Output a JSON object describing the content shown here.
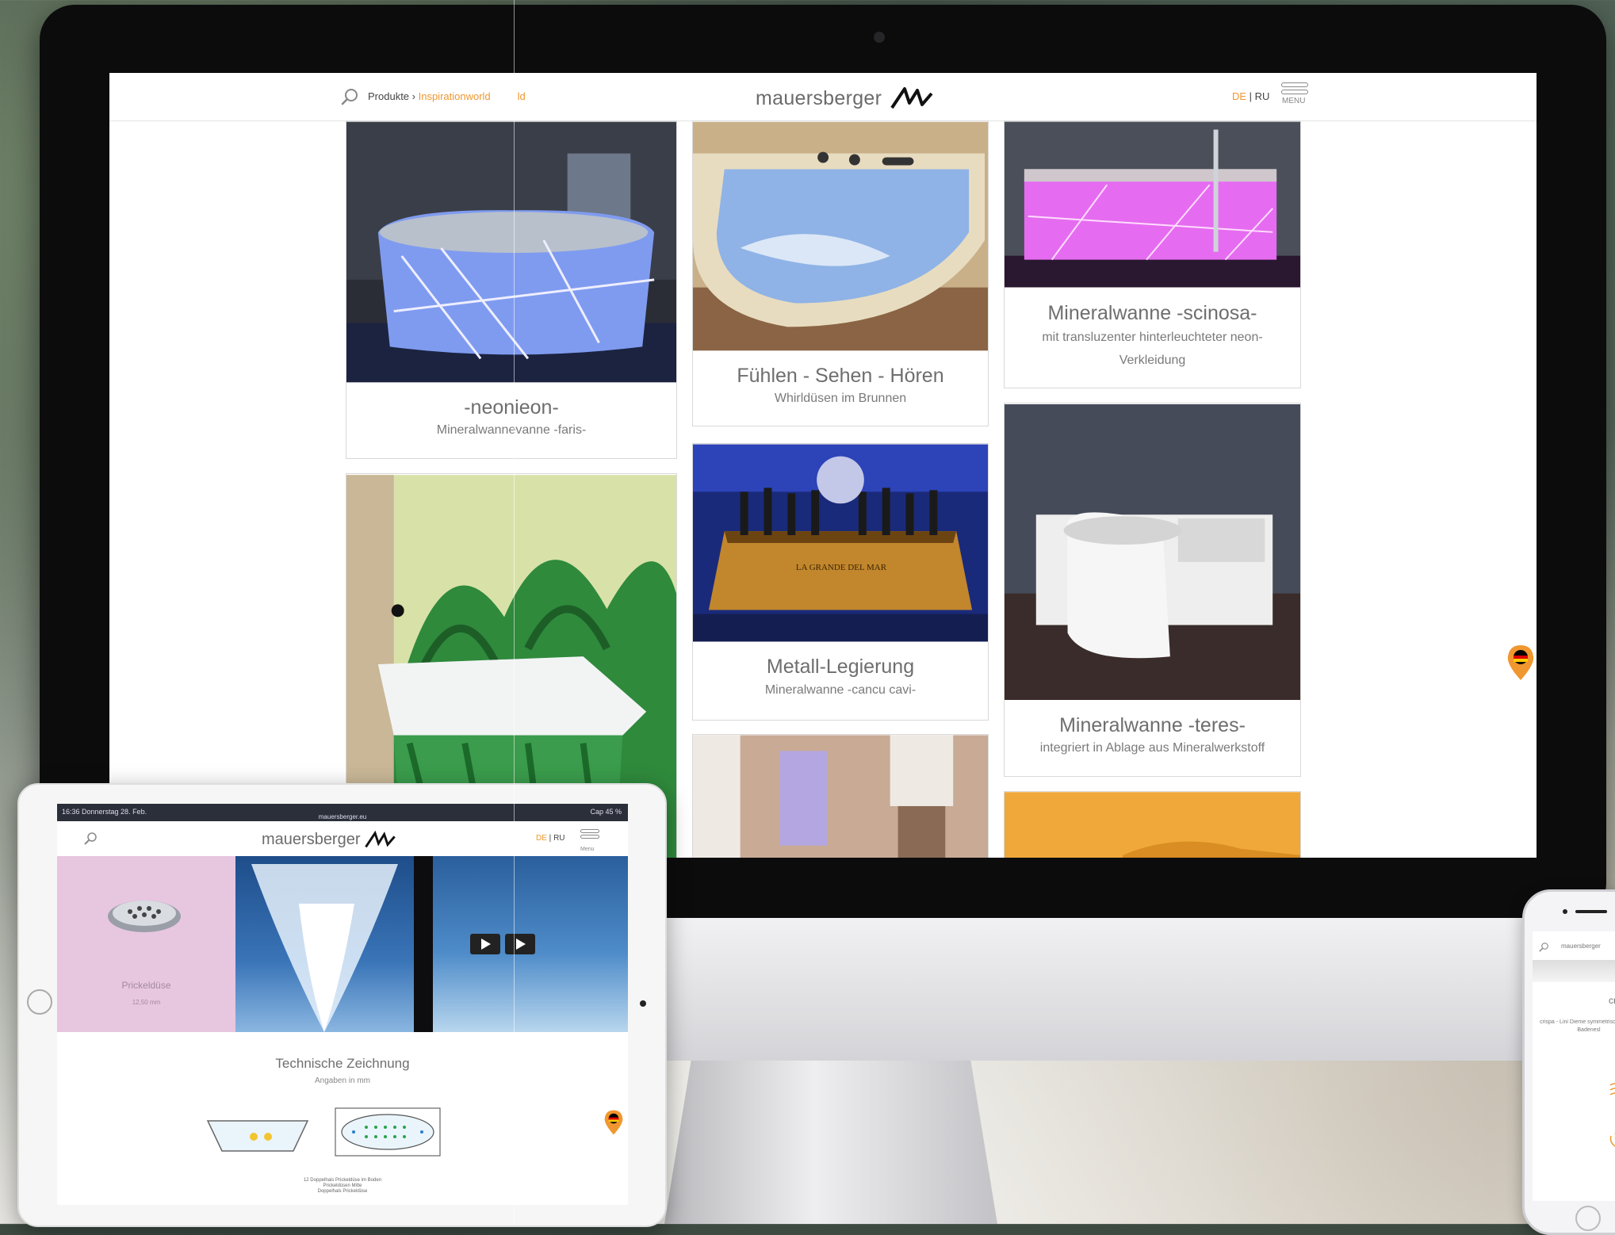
{
  "desktop": {
    "breadcrumb": {
      "root": "Produkte",
      "separator": " › ",
      "current": "Inspirationworld",
      "ghost": "ld"
    },
    "logo": "mauersberger",
    "lang": {
      "de": "DE",
      "sep": " | ",
      "ru": "RU"
    },
    "menu_label": "MENU",
    "cards": [
      {
        "title": "-neonieon-",
        "subtitle": "Mineralwannevanne -faris-"
      },
      {
        "title": "Fühlen - Sehen - Hören",
        "subtitle": "Whirldüsen im Brunnen"
      },
      {
        "title": "Mineralwanne -scinosa-",
        "subtitle": "mit transluzenter hinterleuchteter neon-Verkleidung"
      },
      {
        "title": "Metall-Legierung",
        "subtitle": "Mineralwanne -cancu cavi-"
      },
      {
        "title": "Mineralwanne -teres-",
        "subtitle": "integriert in Ablage aus Mineralwerkstoff"
      }
    ],
    "champagne_text": "LA GRANDE DEL MAR"
  },
  "tablet": {
    "status_left": "16:36 Donnerstag 28. Feb.",
    "status_url": "mauersberger.eu",
    "status_right": "Cap 45 %",
    "logo": "mauersberger",
    "lang": {
      "de": "DE",
      "sep": " | ",
      "ru": "RU"
    },
    "menu_label": "Menu",
    "tile_label": "Prickeldüse",
    "tile_sublabel": "12,50 mm",
    "heading": "Technische Zeichnung",
    "subheading": "Angaben in mm",
    "legend": [
      "12 Doppelhals Prickeldüse im Boden",
      "Prickeldüsen Mitte",
      "Doppelhals Prickeldüse"
    ]
  },
  "phone": {
    "logo": "mauersberger",
    "title": "crisp",
    "body": "crispa - Lini Dieme symmetrischer Form Badenesl"
  },
  "colors": {
    "accent": "#f0972f",
    "text": "#6e6e6e",
    "border": "#d9d9d9"
  },
  "icons": [
    "search-icon",
    "menu-icon",
    "location-pin-icon",
    "play-icon",
    "home-button",
    "camera-icon"
  ]
}
